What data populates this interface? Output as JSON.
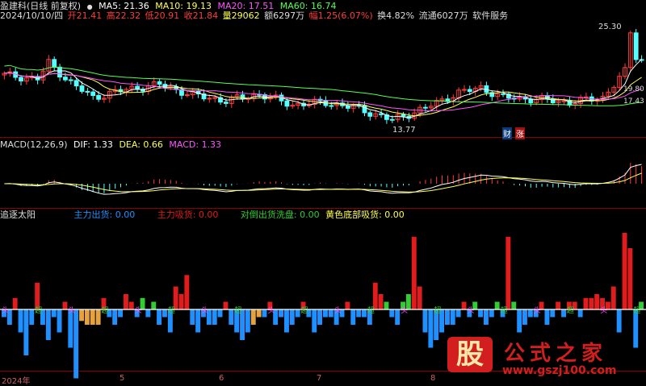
{
  "top": {
    "stock": "盈建科(日线 前复权)",
    "ma5": "MA5: 21.36",
    "ma10": "MA10: 19.13",
    "ma20": "MA20: 17.51",
    "ma60": "MA60: 16.74",
    "date": "2024/10/10/四",
    "open": "开21.41",
    "high": "高22.32",
    "low": "低20.91",
    "close": "收21.84",
    "volume": "量29062",
    "amount": "额6297万",
    "change": "幅1.25(6.07%)",
    "turnover": "换4.82%",
    "float": "流通6027万",
    "service": "软件服务",
    "max_label": "25.30",
    "min_label": "13.77",
    "price_labels": [
      "19.80",
      "17.43"
    ],
    "tags": [
      "财",
      "涨"
    ]
  },
  "macd": {
    "title": "MACD(12,26,9)",
    "dif": "DIF: 1.33",
    "dea": "DEA: 0.66",
    "macd": "MACD: 1.33"
  },
  "ind": {
    "title": "追逐太阳",
    "l1": "主力出货: 0.00",
    "l2": "主力吸货: 0.00",
    "l3": "对倒出货洗盘: 0.00",
    "l4": "黄色底部吸货: 0.00",
    "marker1": "头",
    "marker2": "超"
  },
  "xaxis": [
    "2024年",
    "5",
    "6",
    "7",
    "8"
  ],
  "watermark": {
    "logo": "股",
    "title": "公式之家",
    "url": "www.gszj100.com"
  },
  "colors": {
    "up": "#ff3c3c",
    "down": "#54ffff",
    "ma5": "#ffffff",
    "ma10": "#ffff54",
    "ma20": "#ff54ff",
    "ma60": "#54ff54",
    "red": "#e11c1c",
    "blue": "#1e90ff",
    "green": "#32cd32",
    "orange": "#e6a23c"
  },
  "chart_data": [
    {
      "type": "candlestick",
      "title": "盈建科(日线 前复权)",
      "ylim": [
        12.5,
        26.5
      ],
      "annotations": {
        "max": 25.3,
        "min": 13.77
      },
      "price_labels": [
        19.8,
        17.43
      ]
    },
    {
      "type": "line",
      "title": "MACD(12,26,9)",
      "series": [
        {
          "name": "DIF",
          "last": 1.33
        },
        {
          "name": "DEA",
          "last": 0.66
        },
        {
          "name": "MACD",
          "last": 1.33
        }
      ]
    },
    {
      "type": "bar",
      "title": "追逐太阳",
      "series": [
        {
          "name": "主力出货",
          "last": 0.0
        },
        {
          "name": "主力吸货",
          "last": 0.0
        },
        {
          "name": "对倒出货洗盘",
          "last": 0.0
        },
        {
          "name": "黄色底部吸货",
          "last": 0.0
        }
      ],
      "bars": [
        {
          "i": 0,
          "v": -1,
          "c": "blue"
        },
        {
          "i": 1,
          "v": -2,
          "c": "blue"
        },
        {
          "i": 2,
          "v": 1.5,
          "c": "red"
        },
        {
          "i": 3,
          "v": -3,
          "c": "blue"
        },
        {
          "i": 4,
          "v": -6,
          "c": "blue"
        },
        {
          "i": 5,
          "v": -2,
          "c": "blue"
        },
        {
          "i": 6,
          "v": 3.5,
          "c": "red"
        },
        {
          "i": 7,
          "v": -2,
          "c": "blue"
        },
        {
          "i": 8,
          "v": -4,
          "c": "blue"
        },
        {
          "i": 9,
          "v": -1,
          "c": "blue"
        },
        {
          "i": 10,
          "v": -3,
          "c": "blue"
        },
        {
          "i": 11,
          "v": 1,
          "c": "red"
        },
        {
          "i": 12,
          "v": -5,
          "c": "blue"
        },
        {
          "i": 13,
          "v": -9,
          "c": "blue"
        },
        {
          "i": 14,
          "v": -1.5,
          "c": "orange"
        },
        {
          "i": 15,
          "v": -2,
          "c": "orange"
        },
        {
          "i": 16,
          "v": -2,
          "c": "orange"
        },
        {
          "i": 17,
          "v": -2,
          "c": "orange"
        },
        {
          "i": 18,
          "v": 1.5,
          "c": "red"
        },
        {
          "i": 19,
          "v": -1,
          "c": "blue"
        },
        {
          "i": 20,
          "v": -2,
          "c": "blue"
        },
        {
          "i": 21,
          "v": -1,
          "c": "blue"
        },
        {
          "i": 22,
          "v": 2,
          "c": "red"
        },
        {
          "i": 23,
          "v": 1,
          "c": "red"
        },
        {
          "i": 24,
          "v": -1,
          "c": "blue"
        },
        {
          "i": 25,
          "v": 1.5,
          "c": "green"
        },
        {
          "i": 26,
          "v": -1,
          "c": "blue"
        },
        {
          "i": 27,
          "v": 1,
          "c": "green"
        },
        {
          "i": 28,
          "v": -2,
          "c": "blue"
        },
        {
          "i": 29,
          "v": -1,
          "c": "blue"
        },
        {
          "i": 30,
          "v": -3,
          "c": "blue"
        },
        {
          "i": 31,
          "v": 3,
          "c": "red"
        },
        {
          "i": 32,
          "v": 2,
          "c": "red"
        },
        {
          "i": 33,
          "v": 4.5,
          "c": "red"
        },
        {
          "i": 34,
          "v": -2,
          "c": "blue"
        },
        {
          "i": 35,
          "v": -3,
          "c": "blue"
        },
        {
          "i": 36,
          "v": -1,
          "c": "blue"
        },
        {
          "i": 37,
          "v": -2,
          "c": "blue"
        },
        {
          "i": 38,
          "v": -2,
          "c": "blue"
        },
        {
          "i": 39,
          "v": -1,
          "c": "blue"
        },
        {
          "i": 40,
          "v": 1,
          "c": "red"
        },
        {
          "i": 41,
          "v": -2,
          "c": "blue"
        },
        {
          "i": 42,
          "v": -3,
          "c": "blue"
        },
        {
          "i": 43,
          "v": -4,
          "c": "blue"
        },
        {
          "i": 44,
          "v": -3,
          "c": "blue"
        },
        {
          "i": 45,
          "v": -2,
          "c": "orange"
        },
        {
          "i": 46,
          "v": -1,
          "c": "orange"
        },
        {
          "i": 47,
          "v": -1,
          "c": "blue"
        },
        {
          "i": 48,
          "v": 1,
          "c": "red"
        },
        {
          "i": 49,
          "v": -2,
          "c": "blue"
        },
        {
          "i": 50,
          "v": -1,
          "c": "blue"
        },
        {
          "i": 51,
          "v": -3,
          "c": "blue"
        },
        {
          "i": 52,
          "v": -2,
          "c": "blue"
        },
        {
          "i": 53,
          "v": -1,
          "c": "blue"
        },
        {
          "i": 54,
          "v": 1,
          "c": "red"
        },
        {
          "i": 55,
          "v": -1,
          "c": "blue"
        },
        {
          "i": 56,
          "v": -3,
          "c": "blue"
        },
        {
          "i": 57,
          "v": -2,
          "c": "blue"
        },
        {
          "i": 58,
          "v": -1,
          "c": "blue"
        },
        {
          "i": 59,
          "v": -1,
          "c": "blue"
        },
        {
          "i": 60,
          "v": -2,
          "c": "blue"
        },
        {
          "i": 61,
          "v": -1,
          "c": "blue"
        },
        {
          "i": 62,
          "v": 1,
          "c": "red"
        },
        {
          "i": 63,
          "v": -2,
          "c": "blue"
        },
        {
          "i": 64,
          "v": -1,
          "c": "blue"
        },
        {
          "i": 65,
          "v": -1,
          "c": "blue"
        },
        {
          "i": 66,
          "v": -2,
          "c": "blue"
        },
        {
          "i": 67,
          "v": 3.5,
          "c": "red"
        },
        {
          "i": 68,
          "v": 2,
          "c": "red"
        },
        {
          "i": 69,
          "v": 1,
          "c": "green"
        },
        {
          "i": 70,
          "v": -1,
          "c": "blue"
        },
        {
          "i": 71,
          "v": -2,
          "c": "blue"
        },
        {
          "i": 72,
          "v": 1,
          "c": "green"
        },
        {
          "i": 73,
          "v": 2,
          "c": "green"
        },
        {
          "i": 74,
          "v": 9.5,
          "c": "red"
        },
        {
          "i": 75,
          "v": 3,
          "c": "red"
        },
        {
          "i": 76,
          "v": -3,
          "c": "blue"
        },
        {
          "i": 77,
          "v": -5,
          "c": "blue"
        },
        {
          "i": 78,
          "v": -4,
          "c": "blue"
        },
        {
          "i": 79,
          "v": -3,
          "c": "blue"
        },
        {
          "i": 80,
          "v": -2,
          "c": "blue"
        },
        {
          "i": 81,
          "v": -2,
          "c": "blue"
        },
        {
          "i": 82,
          "v": -1,
          "c": "blue"
        },
        {
          "i": 83,
          "v": 1,
          "c": "red"
        },
        {
          "i": 84,
          "v": -1,
          "c": "blue"
        },
        {
          "i": 85,
          "v": 1,
          "c": "green"
        },
        {
          "i": 86,
          "v": -1,
          "c": "blue"
        },
        {
          "i": 87,
          "v": -2,
          "c": "blue"
        },
        {
          "i": 88,
          "v": -1,
          "c": "blue"
        },
        {
          "i": 89,
          "v": 1,
          "c": "green"
        },
        {
          "i": 90,
          "v": -1,
          "c": "blue"
        },
        {
          "i": 91,
          "v": 9.5,
          "c": "red"
        },
        {
          "i": 92,
          "v": 1,
          "c": "green"
        },
        {
          "i": 93,
          "v": -3,
          "c": "blue"
        },
        {
          "i": 94,
          "v": -2,
          "c": "blue"
        },
        {
          "i": 95,
          "v": -1,
          "c": "blue"
        },
        {
          "i": 96,
          "v": -1,
          "c": "blue"
        },
        {
          "i": 97,
          "v": 1,
          "c": "red"
        },
        {
          "i": 98,
          "v": -2,
          "c": "blue"
        },
        {
          "i": 99,
          "v": -1,
          "c": "blue"
        },
        {
          "i": 100,
          "v": 1,
          "c": "red"
        },
        {
          "i": 101,
          "v": -1,
          "c": "blue"
        },
        {
          "i": 102,
          "v": 1,
          "c": "red"
        },
        {
          "i": 103,
          "v": 1,
          "c": "red"
        },
        {
          "i": 104,
          "v": -1,
          "c": "blue"
        },
        {
          "i": 105,
          "v": 1.5,
          "c": "red"
        },
        {
          "i": 106,
          "v": 1.5,
          "c": "red"
        },
        {
          "i": 107,
          "v": 2,
          "c": "red"
        },
        {
          "i": 108,
          "v": 1.5,
          "c": "red"
        },
        {
          "i": 109,
          "v": 1,
          "c": "red"
        },
        {
          "i": 110,
          "v": 3,
          "c": "red"
        },
        {
          "i": 111,
          "v": -3,
          "c": "blue"
        },
        {
          "i": 112,
          "v": 10,
          "c": "red"
        },
        {
          "i": 113,
          "v": 8,
          "c": "red"
        },
        {
          "i": 114,
          "v": -5,
          "c": "blue"
        },
        {
          "i": 115,
          "v": 1,
          "c": "green"
        }
      ]
    }
  ]
}
